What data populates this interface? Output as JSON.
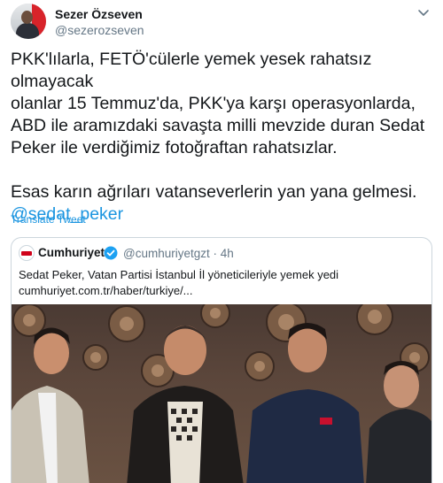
{
  "tweet": {
    "author_name": "Sezer Özseven",
    "author_handle": "@sezerozseven",
    "body_lines": [
      "PKK'lılarla, FETÖ'cülerle yemek yesek rahatsız olmayacak",
      "olanlar 15 Temmuz'da, PKK'ya karşı operasyonlarda,",
      "ABD ile aramızdaki savaşta milli mevzide duran Sedat",
      "Peker ile verdiğimiz fotoğraftan rahatsızlar."
    ],
    "body_line_2": "Esas karın ağrıları vatanseverlerin yan yana gelmesi.",
    "mention": "@sedat_peker",
    "translate_label": "Translate Tweet",
    "menu_icon": "chevron-down-icon"
  },
  "quote": {
    "author_name": "Cumhuriyet",
    "verified_icon": "verified-badge-icon",
    "author_handle": "@cumhuriyetgzt",
    "separator": "·",
    "time": "4h",
    "text_line_1": "Sedat Peker, Vatan Partisi İstanbul İl yöneticileriyle yemek yedi",
    "text_line_2": "cumhuriyet.com.tr/haber/turkiye/..."
  },
  "colors": {
    "text": "#14171a",
    "secondary": "#657786",
    "link": "#1b95e0",
    "border": "#ccd6dd",
    "verified": "#1da1f2"
  }
}
